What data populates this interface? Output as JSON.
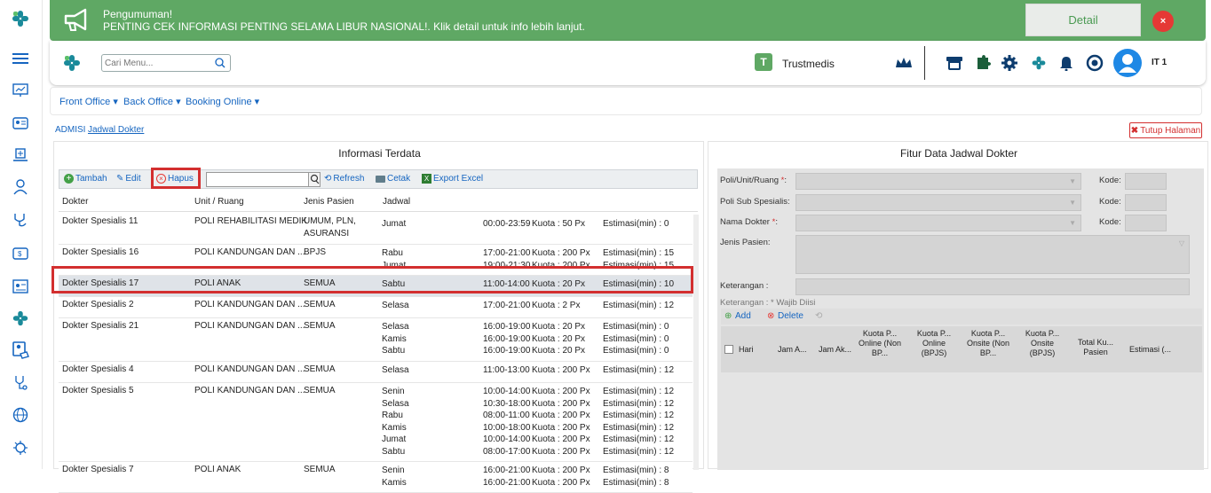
{
  "announcement": {
    "title": "Pengumuman!",
    "message": "PENTING CEK INFORMASI PENTING SELAMA LIBUR NASIONAL!. Klik detail untuk info lebih lanjut.",
    "detail_label": "Detail",
    "close_label": "×"
  },
  "topbar": {
    "search_placeholder": "Cari Menu...",
    "brand": "Trustmedis",
    "user": "IT 1"
  },
  "nav": {
    "items": [
      "Front Office",
      "Back Office",
      "Booking Online"
    ]
  },
  "breadcrumb": {
    "items": [
      "ADMISI",
      "Jadwal Dokter"
    ],
    "close_label": "Tutup Halaman"
  },
  "left_panel": {
    "title": "Informasi Terdata",
    "toolbar": {
      "tambah": "Tambah",
      "edit": "Edit",
      "hapus": "Hapus",
      "refresh": "Refresh",
      "cetak": "Cetak",
      "export": "Export Excel"
    },
    "columns": [
      "Dokter",
      "Unit / Ruang",
      "Jenis Pasien",
      "Jadwal"
    ],
    "rows": [
      {
        "dokter": "Dokter Spesialis 11",
        "unit": "POLI REHABILITASI MEDIK",
        "jenis": "UMUM, PLN, ASURANSI",
        "jadwal": [
          {
            "hari": "Jumat",
            "jam": "00:00-23:59",
            "kuota": "Kuota : 50 Px",
            "est": "Estimasi(min) : 0"
          }
        ]
      },
      {
        "dokter": "Dokter Spesialis 16",
        "unit": "POLI KANDUNGAN DAN ...",
        "jenis": "BPJS",
        "jadwal": [
          {
            "hari": "Rabu",
            "jam": "17:00-21:00",
            "kuota": "Kuota : 200 Px",
            "est": "Estimasi(min) : 15"
          },
          {
            "hari": "Jumat",
            "jam": "19:00-21:30",
            "kuota": "Kuota : 200 Px",
            "est": "Estimasi(min) : 15"
          }
        ]
      },
      {
        "dokter": "Dokter Spesialis 17",
        "unit": "POLI ANAK",
        "jenis": "SEMUA",
        "jadwal": [
          {
            "hari": "Sabtu",
            "jam": "11:00-14:00",
            "kuota": "Kuota : 20 Px",
            "est": "Estimasi(min) : 10"
          }
        ]
      },
      {
        "dokter": "Dokter Spesialis 2",
        "unit": "POLI KANDUNGAN DAN ...",
        "jenis": "SEMUA",
        "jadwal": [
          {
            "hari": "Selasa",
            "jam": "17:00-21:00",
            "kuota": "Kuota : 2 Px",
            "est": "Estimasi(min) : 12"
          }
        ]
      },
      {
        "dokter": "Dokter Spesialis 21",
        "unit": "POLI KANDUNGAN DAN ...",
        "jenis": "SEMUA",
        "jadwal": [
          {
            "hari": "Selasa",
            "jam": "16:00-19:00",
            "kuota": "Kuota : 20 Px",
            "est": "Estimasi(min) : 0"
          },
          {
            "hari": "Kamis",
            "jam": "16:00-19:00",
            "kuota": "Kuota : 20 Px",
            "est": "Estimasi(min) : 0"
          },
          {
            "hari": "Sabtu",
            "jam": "16:00-19:00",
            "kuota": "Kuota : 20 Px",
            "est": "Estimasi(min) : 0"
          }
        ]
      },
      {
        "dokter": "Dokter Spesialis 4",
        "unit": "POLI KANDUNGAN DAN ...",
        "jenis": "SEMUA",
        "jadwal": [
          {
            "hari": "Selasa",
            "jam": "11:00-13:00",
            "kuota": "Kuota : 200 Px",
            "est": "Estimasi(min) : 12"
          }
        ]
      },
      {
        "dokter": "Dokter Spesialis 5",
        "unit": "POLI KANDUNGAN DAN ...",
        "jenis": "SEMUA",
        "jadwal": [
          {
            "hari": "Senin",
            "jam": "10:00-14:00",
            "kuota": "Kuota : 200 Px",
            "est": "Estimasi(min) : 12"
          },
          {
            "hari": "Selasa",
            "jam": "10:30-18:00",
            "kuota": "Kuota : 200 Px",
            "est": "Estimasi(min) : 12"
          },
          {
            "hari": "Rabu",
            "jam": "08:00-11:00",
            "kuota": "Kuota : 200 Px",
            "est": "Estimasi(min) : 12"
          },
          {
            "hari": "Kamis",
            "jam": "10:00-18:00",
            "kuota": "Kuota : 200 Px",
            "est": "Estimasi(min) : 12"
          },
          {
            "hari": "Jumat",
            "jam": "10:00-14:00",
            "kuota": "Kuota : 200 Px",
            "est": "Estimasi(min) : 12"
          },
          {
            "hari": "Sabtu",
            "jam": "08:00-17:00",
            "kuota": "Kuota : 200 Px",
            "est": "Estimasi(min) : 12"
          }
        ]
      },
      {
        "dokter": "Dokter Spesialis 7",
        "unit": "POLI ANAK",
        "jenis": "SEMUA",
        "jadwal": [
          {
            "hari": "Senin",
            "jam": "16:00-21:00",
            "kuota": "Kuota : 200 Px",
            "est": "Estimasi(min) : 8"
          },
          {
            "hari": "Kamis",
            "jam": "16:00-21:00",
            "kuota": "Kuota : 200 Px",
            "est": "Estimasi(min) : 8"
          }
        ]
      }
    ]
  },
  "right_panel": {
    "title": "Fitur Data Jadwal Dokter",
    "fields": {
      "poli": "Poli/Unit/Ruang",
      "sub": "Poli Sub Spesialis:",
      "dokter": "Nama Dokter",
      "jenis": "Jenis Pasien:",
      "ket": "Keterangan :",
      "kode": "Kode:",
      "required": "*",
      "wajib": "Keterangan : * Wajib Diisi"
    },
    "grid_toolbar": {
      "add": "Add",
      "delete": "Delete"
    },
    "grid_columns": [
      "Hari",
      "Jam A...",
      "Jam Ak...",
      "Kuota P... Online (Non BP...",
      "Kuota P... Online (BPJS)",
      "Kuota P... Onsite (Non BP...",
      "Kuota P... Onsite (BPJS)",
      "Total Ku... Pasien",
      "Estimasi (..."
    ]
  },
  "colors": {
    "brand_green": "#5fa864",
    "accent_blue": "#1565c0",
    "highlight_red": "#d32f2f",
    "teal": "#1a8a9a"
  }
}
